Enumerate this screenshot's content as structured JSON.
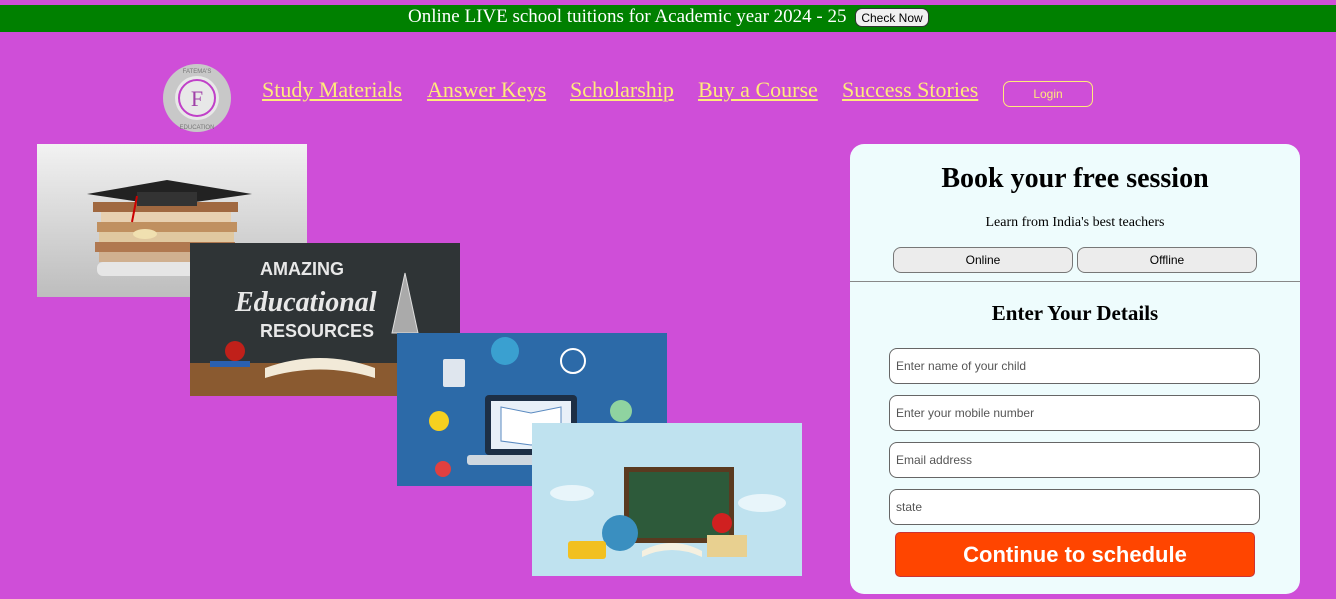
{
  "banner": {
    "text": "Online LIVE school tuitions for Academic year 2024 - 25",
    "button": "Check Now"
  },
  "logo": {
    "letter": "F",
    "ring_text_top": "FATEMA'S",
    "ring_text_bottom": "EDUCATION"
  },
  "nav": {
    "items": [
      "Study Materials",
      "Answer Keys",
      "Scholarship",
      "Buy a Course",
      "Success Stories"
    ],
    "login": "Login"
  },
  "hero_images": {
    "resources": {
      "line1": "AMAZING",
      "line2": "Educational",
      "line3": "RESOURCES"
    }
  },
  "form": {
    "title": "Book your free session",
    "subtitle": "Learn from India's best teachers",
    "modes": [
      "Online",
      "Offline"
    ],
    "details_title": "Enter Your Details",
    "fields": [
      {
        "placeholder": "Enter name of your child"
      },
      {
        "placeholder": "Enter your mobile number"
      },
      {
        "placeholder": "Email address"
      },
      {
        "placeholder": "state"
      }
    ],
    "submit": "Continue to schedule"
  },
  "colors": {
    "background": "#cf4ed8",
    "banner": "#008000",
    "nav_link": "#ffea7a",
    "cta": "#ff4500",
    "card": "#eefcfd"
  }
}
